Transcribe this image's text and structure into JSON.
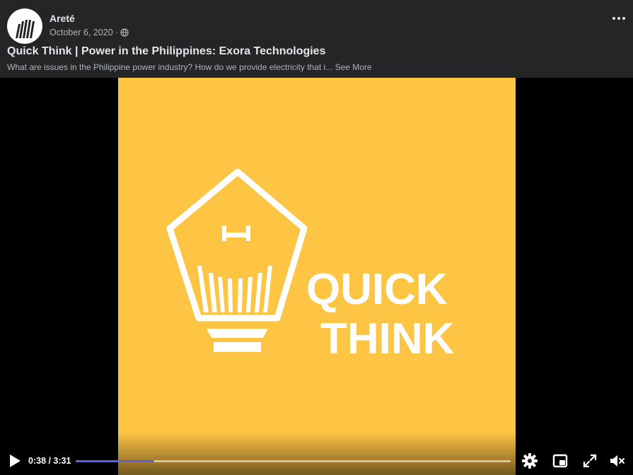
{
  "post": {
    "author": "Areté",
    "date": "October 6, 2020 ·",
    "privacy_icon": "globe-icon",
    "title": "Quick Think | Power in the Philippines: Exora Technologies",
    "description": "What are issues in the Philippine power industry? How do we provide electricity that i...",
    "see_more": "See More"
  },
  "video": {
    "frame_text": [
      "QUICK",
      "THINK"
    ],
    "current_time": "0:38",
    "duration": "3:31",
    "time_display": "0:38 / 3:31",
    "progress": 0.18,
    "controls": [
      "play-icon",
      "settings-icon",
      "picture-in-picture-icon",
      "fullscreen-icon",
      "mute-icon"
    ]
  },
  "colors": {
    "background": "#242526",
    "video_frame": "#fec444",
    "progress_fill": "#5b60e6"
  }
}
